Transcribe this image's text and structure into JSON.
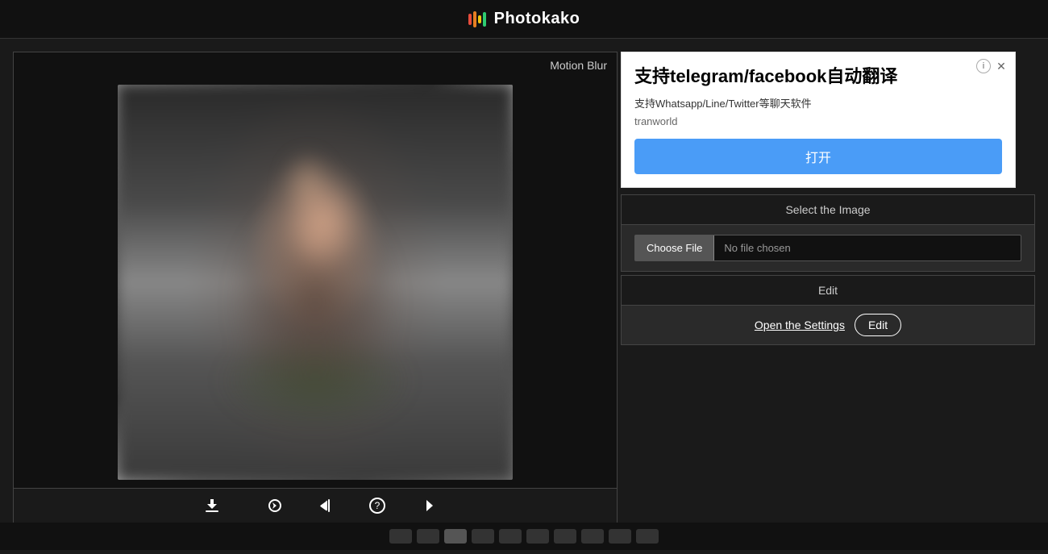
{
  "header": {
    "title": "Photokako",
    "logo_alt": "Photokako logo"
  },
  "left_panel": {
    "title": "Motion Blur"
  },
  "toolbar": {
    "items": [
      {
        "id": "download",
        "icon": "⬇",
        "label": "Download"
      },
      {
        "id": "original",
        "icon": "↺",
        "label": "Original"
      },
      {
        "id": "last",
        "icon": "↻",
        "label": "Last"
      },
      {
        "id": "random",
        "icon": "?",
        "label": "Random"
      },
      {
        "id": "next",
        "icon": "→",
        "label": "Next"
      }
    ]
  },
  "ad": {
    "title": "支持telegram/facebook自动翻译",
    "subtitle": "支持Whatsapp/Line/Twitter等聊天软件",
    "brand": "tranworld",
    "button_label": "打开"
  },
  "select_section": {
    "header": "Select the Image",
    "choose_file_label": "Choose File",
    "no_file_label": "No file chosen"
  },
  "edit_section": {
    "header": "Edit",
    "open_settings_label": "Open the Settings",
    "edit_button_label": "Edit"
  }
}
